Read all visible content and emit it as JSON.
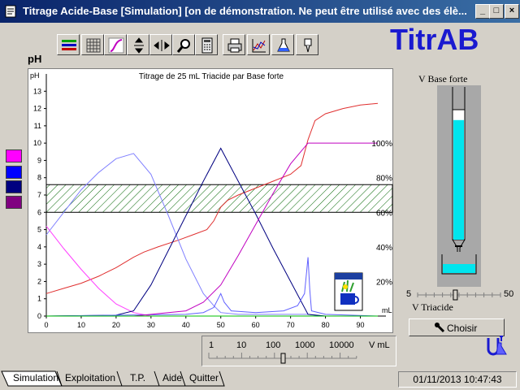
{
  "window": {
    "title": "Titrage Acide-Base [Simulation] [on de démonstration. Ne peut être utilisé avec des élè...",
    "min_label": "_",
    "max_label": "□",
    "close_label": "×"
  },
  "toolbar": {
    "icons": [
      "lines-icon",
      "grid-icon",
      "curve-icon",
      "vertical-arrows-icon",
      "horizontal-arrows-icon",
      "magnifier-icon",
      "calculator-icon",
      "printer-icon",
      "chart-icon",
      "flask-icon",
      "pen-icon"
    ]
  },
  "logo": "TitrAB",
  "ph_label": "pH",
  "swatches": [
    "#ff00ff",
    "#0000ff",
    "#000080",
    "#800080"
  ],
  "chart_data": {
    "type": "line",
    "title": "Titrage de 25 mL Triacide par Base forte",
    "ylabel": "pH",
    "xlabel": "mL",
    "xlim": [
      0,
      95
    ],
    "ylim": [
      0,
      14
    ],
    "x_ticks": [
      0,
      10,
      20,
      30,
      40,
      50,
      60,
      70,
      80,
      90
    ],
    "y_ticks": [
      0,
      1,
      2,
      3,
      4,
      5,
      6,
      7,
      8,
      9,
      10,
      11,
      12,
      13
    ],
    "right_ticks": [
      "100%",
      "80%",
      "60%",
      "40%",
      "20%"
    ],
    "indicator_zone": [
      6.0,
      7.6
    ],
    "series": [
      {
        "color": "#e03030",
        "points": [
          [
            0,
            1.3
          ],
          [
            5,
            1.6
          ],
          [
            10,
            1.9
          ],
          [
            15,
            2.3
          ],
          [
            20,
            2.8
          ],
          [
            25,
            3.4
          ],
          [
            28,
            3.7
          ],
          [
            32,
            4.0
          ],
          [
            38,
            4.4
          ],
          [
            42,
            4.7
          ],
          [
            46,
            5.0
          ],
          [
            48,
            5.5
          ],
          [
            50,
            6.3
          ],
          [
            52,
            6.7
          ],
          [
            55,
            7.0
          ],
          [
            60,
            7.4
          ],
          [
            65,
            7.8
          ],
          [
            70,
            8.2
          ],
          [
            73,
            8.7
          ],
          [
            75,
            10.2
          ],
          [
            77,
            11.3
          ],
          [
            80,
            11.7
          ],
          [
            85,
            12.0
          ],
          [
            90,
            12.2
          ],
          [
            95,
            12.3
          ]
        ]
      },
      {
        "color": "#8080ff",
        "points": [
          [
            0,
            4.7
          ],
          [
            5,
            6.0
          ],
          [
            10,
            7.3
          ],
          [
            15,
            8.3
          ],
          [
            20,
            9.1
          ],
          [
            25,
            9.4
          ],
          [
            30,
            8.2
          ],
          [
            35,
            5.8
          ],
          [
            40,
            3.3
          ],
          [
            45,
            1.3
          ],
          [
            48,
            0.6
          ],
          [
            50,
            0.2
          ],
          [
            55,
            0.1
          ],
          [
            60,
            0.1
          ],
          [
            70,
            0.1
          ],
          [
            75,
            0.1
          ],
          [
            80,
            0.0
          ],
          [
            95,
            0.0
          ]
        ]
      },
      {
        "color": "#ff40ff",
        "points": [
          [
            0,
            5.2
          ],
          [
            5,
            3.9
          ],
          [
            10,
            2.7
          ],
          [
            15,
            1.6
          ],
          [
            20,
            0.7
          ],
          [
            25,
            0.2
          ],
          [
            30,
            0.0
          ],
          [
            95,
            0.0
          ]
        ]
      },
      {
        "color": "#000080",
        "points": [
          [
            0,
            0.0
          ],
          [
            20,
            0.05
          ],
          [
            25,
            0.3
          ],
          [
            30,
            1.8
          ],
          [
            35,
            3.8
          ],
          [
            40,
            5.8
          ],
          [
            45,
            7.8
          ],
          [
            50,
            9.7
          ],
          [
            55,
            7.8
          ],
          [
            60,
            5.9
          ],
          [
            65,
            3.9
          ],
          [
            70,
            2.0
          ],
          [
            75,
            0.1
          ],
          [
            80,
            0.0
          ],
          [
            95,
            0.0
          ]
        ]
      },
      {
        "color": "#6060ff",
        "points": [
          [
            0,
            0.0
          ],
          [
            40,
            0.1
          ],
          [
            45,
            0.2
          ],
          [
            48,
            0.5
          ],
          [
            50,
            1.3
          ],
          [
            51,
            0.8
          ],
          [
            53,
            0.3
          ],
          [
            60,
            0.2
          ],
          [
            68,
            0.3
          ],
          [
            72,
            0.6
          ],
          [
            74,
            1.3
          ],
          [
            75,
            3.4
          ],
          [
            75.5,
            1.5
          ],
          [
            76,
            0.3
          ],
          [
            80,
            0.1
          ],
          [
            95,
            0.0
          ]
        ]
      },
      {
        "color": "#c000c0",
        "points": [
          [
            0,
            0.0
          ],
          [
            25,
            0.0
          ],
          [
            30,
            0.1
          ],
          [
            40,
            0.3
          ],
          [
            45,
            0.8
          ],
          [
            50,
            1.8
          ],
          [
            55,
            3.5
          ],
          [
            60,
            5.3
          ],
          [
            65,
            7.1
          ],
          [
            70,
            8.8
          ],
          [
            75,
            10.0
          ],
          [
            80,
            10.0
          ],
          [
            95,
            10.0
          ]
        ]
      },
      {
        "color": "#00c000",
        "points": [
          [
            0,
            0.0
          ],
          [
            95,
            0.0
          ]
        ]
      }
    ]
  },
  "burette": {
    "label": "V Base forte",
    "fill_fraction": 0.92
  },
  "triacide_slider": {
    "min_label": "5",
    "max_label": "50",
    "label": "V Triacide",
    "value_fraction": 0.45
  },
  "choisir_label": "Choisir",
  "volume_slider": {
    "ticks": [
      "1",
      "10",
      "100",
      "1000",
      "10000"
    ],
    "unit": "V mL",
    "value_fraction": 0.5
  },
  "tabs": [
    "Simulation",
    "Exploitation",
    "T.P.",
    "Aide",
    "Quitter"
  ],
  "status": "01/11/2013 10:47:43"
}
